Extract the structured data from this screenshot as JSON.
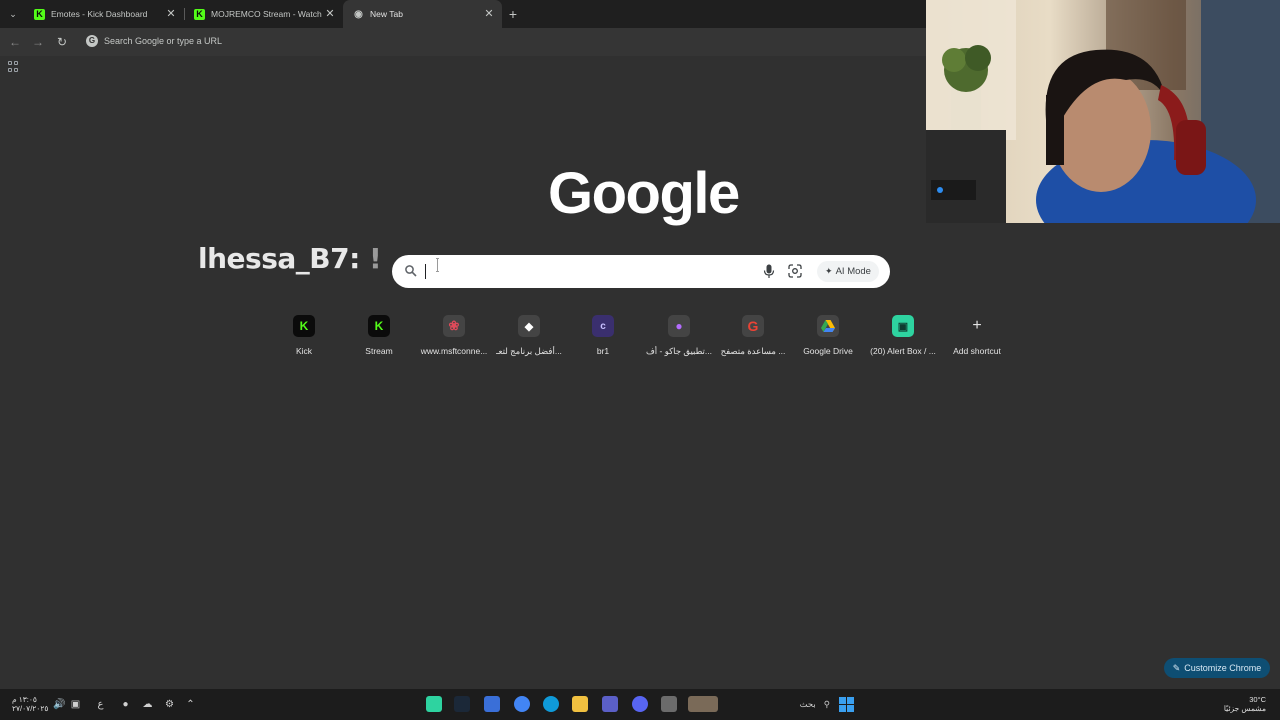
{
  "tabs": [
    {
      "title": "Emotes - Kick Dashboard",
      "favicon": "kick-icon"
    },
    {
      "title": "MOJREMCO Stream - Watch Li",
      "favicon": "kick-icon"
    },
    {
      "title": "New Tab",
      "favicon": "chrome-icon",
      "active": true
    }
  ],
  "toolbar": {
    "omnibox_placeholder": "Search Google or type a URL"
  },
  "ntp": {
    "logo": "Google",
    "search_placeholder": "",
    "ai_mode_label": "AI Mode",
    "customize_label": "Customize Chrome"
  },
  "overlay": {
    "chat_user": "lhessa_B7:",
    "chat_tail": "!"
  },
  "shortcuts": [
    {
      "label": "Kick",
      "icon": "kick-icon",
      "color": "#53fc18"
    },
    {
      "label": "Stream",
      "icon": "kick-icon",
      "color": "#53fc18"
    },
    {
      "label": "www.msftconne...",
      "icon": "huawei-icon",
      "color": "#e04a5a"
    },
    {
      "label": "أفضل برنامج لتعـ...",
      "icon": "diamond-icon",
      "color": "#ffffff"
    },
    {
      "label": "br1",
      "icon": "c-icon",
      "color": "#3a2f6e"
    },
    {
      "label": "تطبيق جاكو - أف...",
      "icon": "jaco-icon",
      "color": "#9b3cf0"
    },
    {
      "label": "مساعدة متصفح ...",
      "icon": "google-icon",
      "color": "#4285f4"
    },
    {
      "label": "Google Drive",
      "icon": "drive-icon",
      "color": "#34a853"
    },
    {
      "label": "(20) Alert Box / ...",
      "icon": "alertbox-icon",
      "color": "#2ed3a0"
    },
    {
      "label": "Add shortcut",
      "icon": "plus-icon",
      "color": "#e3e3e3"
    }
  ],
  "taskbar": {
    "time": "١٣:٠٥ م",
    "date": "٢٧/٠٧/٢٠٢٥",
    "lang": "ع",
    "search_label": "بحث",
    "temperature": "30°C",
    "weather": "مشمس جزئيًا"
  }
}
